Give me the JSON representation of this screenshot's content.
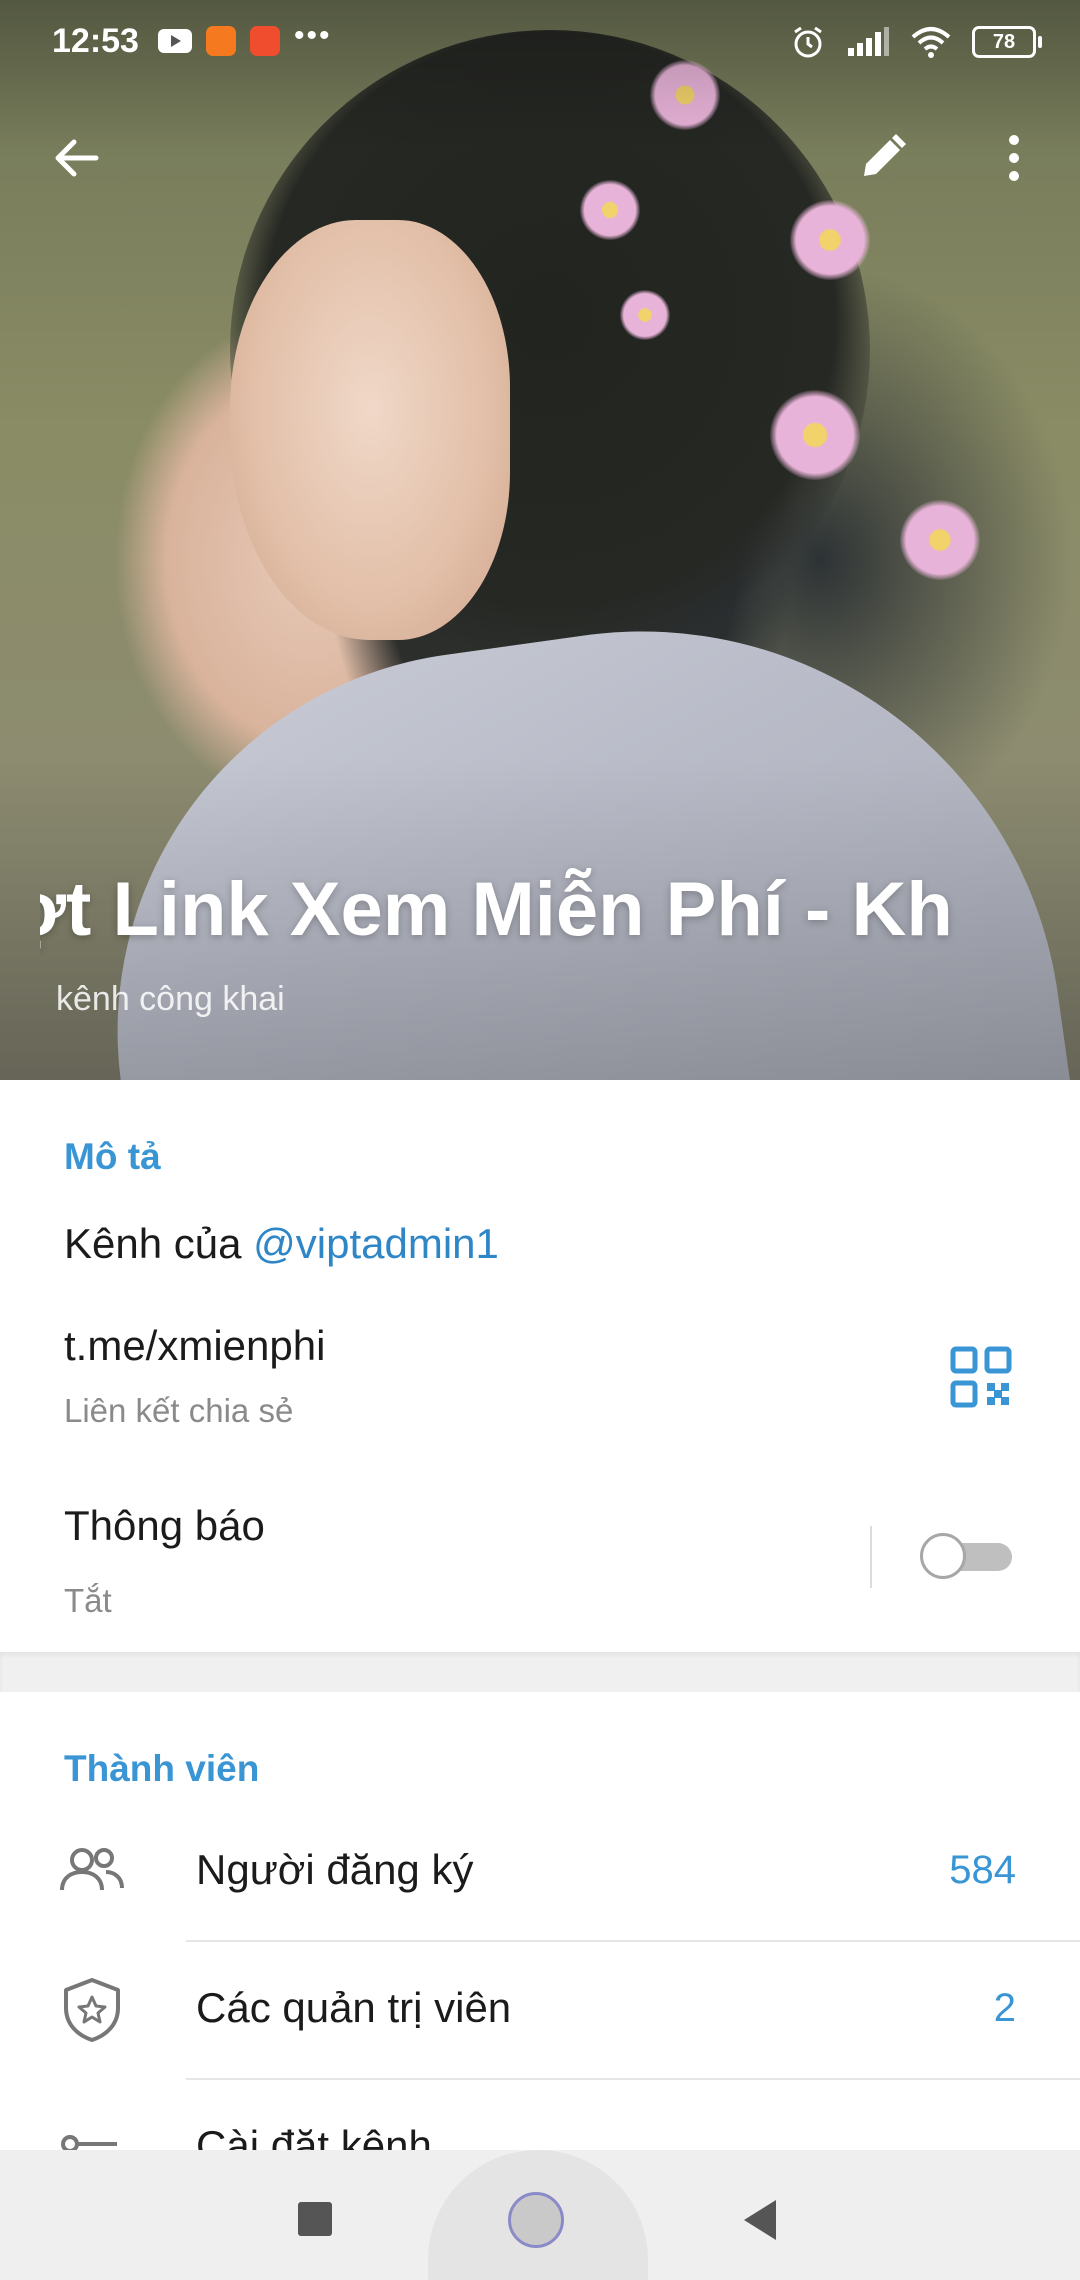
{
  "status_bar": {
    "time": "12:53",
    "battery": "78"
  },
  "header": {
    "title": "ợt Link   Xem Miễn Phí - Kh",
    "subtitle": "kênh công khai"
  },
  "info": {
    "section_title": "Mô tả",
    "description_prefix": "Kênh của ",
    "description_mention": "@viptadmin1",
    "link_value": "t.me/xmienphi",
    "link_label": "Liên kết chia sẻ",
    "notifications_label": "Thông báo",
    "notifications_value": "Tắt",
    "notifications_enabled": false
  },
  "members": {
    "section_title": "Thành viên",
    "rows": [
      {
        "label": "Người đăng ký",
        "value": "584",
        "icon": "people-icon"
      },
      {
        "label": "Các quản trị viên",
        "value": "2",
        "icon": "shield-star-icon"
      },
      {
        "label": "Cài đặt kênh",
        "value": "",
        "icon": "settings-key-icon"
      }
    ]
  },
  "colors": {
    "accent": "#3a95d5",
    "link": "#2e86c7"
  }
}
